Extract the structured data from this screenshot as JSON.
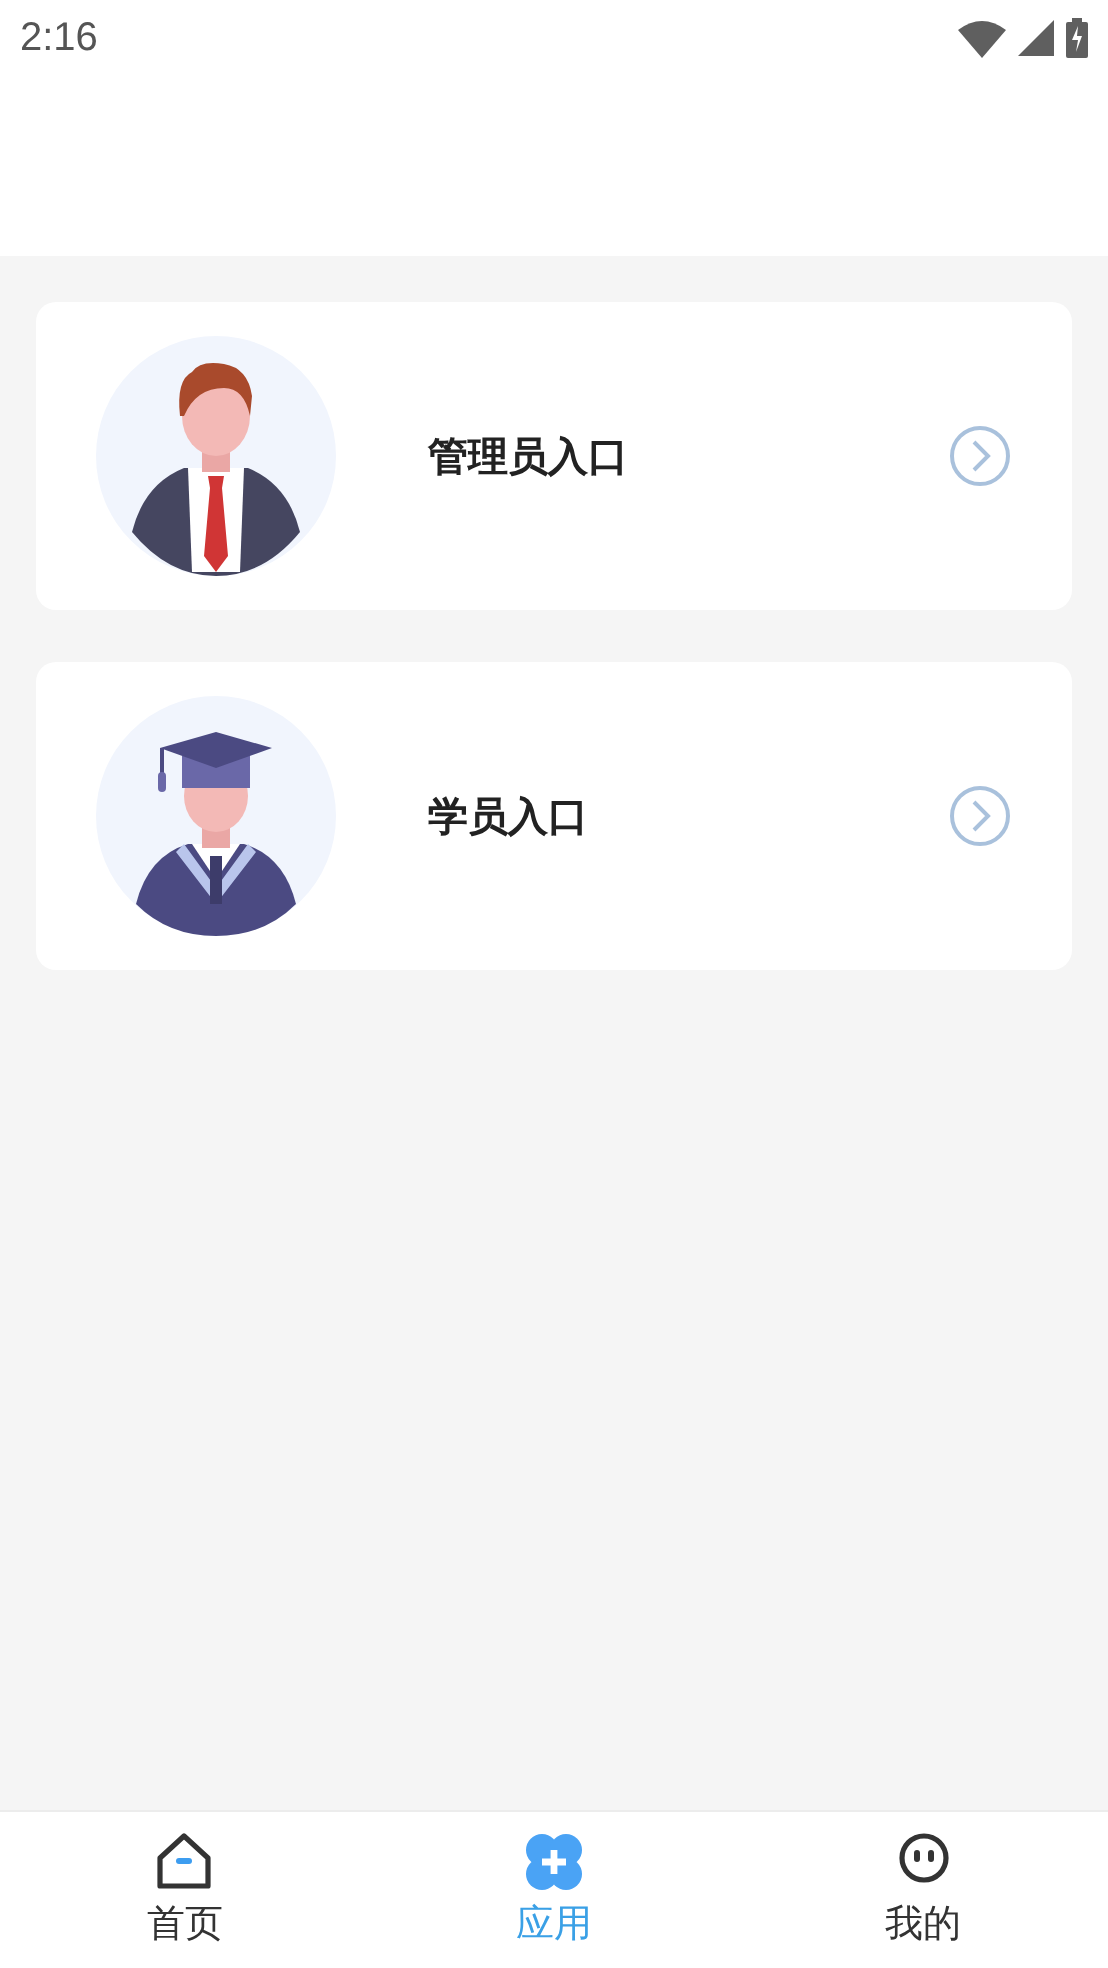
{
  "status_bar": {
    "time": "2:16"
  },
  "entries": [
    {
      "kind": "admin",
      "label": "管理员入口"
    },
    {
      "kind": "student",
      "label": "学员入口"
    }
  ],
  "tabs": [
    {
      "kind": "home",
      "label": "首页",
      "selected": false
    },
    {
      "kind": "apps",
      "label": "应用",
      "selected": true
    },
    {
      "kind": "person",
      "label": "我的",
      "selected": false
    }
  ]
}
